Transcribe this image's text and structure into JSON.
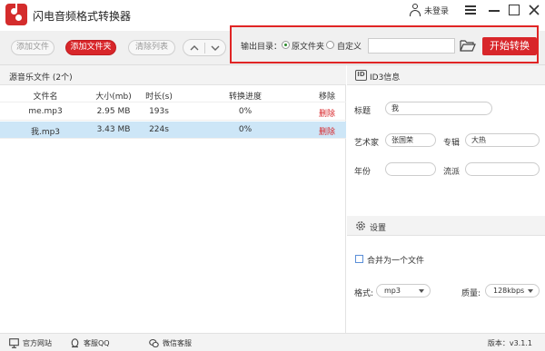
{
  "app": {
    "title": "闪电音频格式转换器",
    "login": "未登录"
  },
  "toolbar": {
    "add_file": "添加文件",
    "add_folder": "添加文件夹",
    "clear_list": "清除列表"
  },
  "output": {
    "label": "输出目录：",
    "option_original": "原文件夹",
    "option_custom": "自定义",
    "selected_option": "原文件夹",
    "path_value": "",
    "start_button": "开始转换"
  },
  "source": {
    "title": "源音乐文件 (2个)",
    "columns": [
      "文件名",
      "大小(mb)",
      "时长(s)",
      "转换进度",
      "移除"
    ],
    "rows": [
      {
        "name": "me.mp3",
        "size": "2.95 MB",
        "duration": "193s",
        "progress": "0%",
        "remove": "删除",
        "selected": false
      },
      {
        "name": "我.mp3",
        "size": "3.43 MB",
        "duration": "224s",
        "progress": "0%",
        "remove": "删除",
        "selected": true
      }
    ]
  },
  "id3": {
    "title": "ID3信息",
    "fields": {
      "title_label": "标题",
      "title_value": "我",
      "artist_label": "艺术家",
      "artist_value": "张国荣",
      "album_label": "专辑",
      "album_value": "大热",
      "year_label": "年份",
      "year_value": "",
      "genre_label": "流派",
      "genre_value": ""
    }
  },
  "settings": {
    "title": "设置",
    "merge_label": "合并为一个文件",
    "merge_checked": false,
    "format_label": "格式:",
    "format_value": "mp3",
    "quality_label": "质量:",
    "quality_value": "128kbps"
  },
  "status": {
    "website": "官方网站",
    "qq": "客服QQ",
    "wechat": "微信客服",
    "version": "版本：v3.1.1"
  },
  "colors": {
    "accent": "#d8262a",
    "selected_row": "#cde6f7",
    "panel_bg": "#f3f3f3"
  },
  "icons": {
    "app": "app-music-logo-icon",
    "user": "user-icon",
    "menu": "hamburger-menu-icon",
    "minimize": "minimize-icon",
    "maximize": "maximize-icon",
    "close": "close-icon",
    "move_up": "arrow-up-icon",
    "move_down": "arrow-down-icon",
    "folder": "open-folder-icon",
    "id3": "id3-icon",
    "settings": "gear-icon",
    "website": "monitor-icon",
    "qq": "qq-icon",
    "wechat": "wechat-icon"
  }
}
